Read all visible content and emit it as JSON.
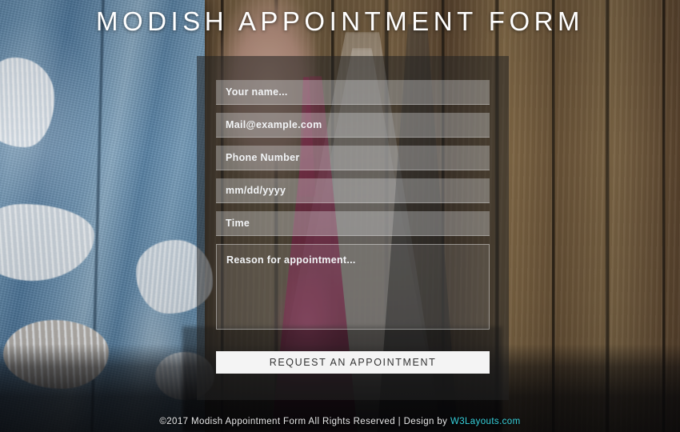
{
  "page": {
    "title": "MODISH APPOINTMENT FORM",
    "background_colors": {
      "denim": "#5d87ab",
      "wood": "#6d5438",
      "pink_dress": "#d6286c",
      "panel_overlay": "rgba(35,35,35,0.55)"
    }
  },
  "form": {
    "fields": [
      {
        "name": "your-name",
        "placeholder": "Your name...",
        "type": "text",
        "value": ""
      },
      {
        "name": "email",
        "placeholder": "Mail@example.com",
        "type": "email",
        "value": ""
      },
      {
        "name": "phone",
        "placeholder": "Phone Number",
        "type": "tel",
        "value": ""
      },
      {
        "name": "date",
        "placeholder": "mm/dd/yyyy",
        "type": "text",
        "value": ""
      },
      {
        "name": "time",
        "placeholder": "Time",
        "type": "text",
        "value": ""
      },
      {
        "name": "reason",
        "placeholder": "Reason for appointment...",
        "type": "textarea",
        "value": ""
      }
    ],
    "submit_label": "Request an Appointment"
  },
  "footer": {
    "text": "©2017 Modish Appointment Form All Rights Reserved | Design by ",
    "link_label": "W3Layouts.com",
    "link_color": "#36d1dc"
  }
}
